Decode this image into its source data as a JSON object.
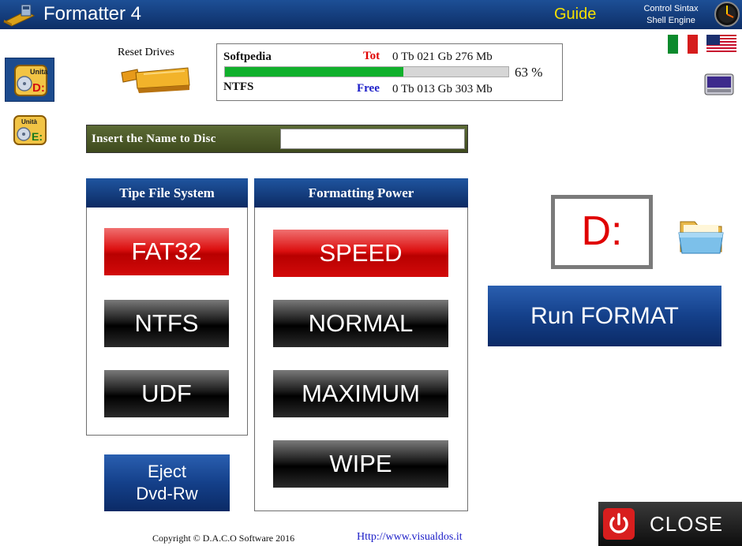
{
  "app": {
    "title": "Formatter 4",
    "guide_label": "Guide",
    "control_syntax_line1": "Control Sintax",
    "control_syntax_line2": "Shell Engine"
  },
  "sidebar": {
    "drive_d_label": "Unità",
    "drive_d_letter": "D:",
    "drive_e_label": "Unità",
    "drive_e_letter": "E:"
  },
  "reset": {
    "label": "Reset Drives"
  },
  "drive_info": {
    "name": "Softpedia",
    "file_system": "NTFS",
    "tot_label": "Tot",
    "tot_value": "0 Tb 021 Gb 276 Mb",
    "free_label": "Free",
    "free_value": "0 Tb 013 Gb 303 Mb",
    "used_percent": 63,
    "used_percent_text": "63 %"
  },
  "name_bar": {
    "label": "Insert the Name to Disc",
    "value": ""
  },
  "file_system_group": {
    "title": "Tipe File System",
    "options": [
      "FAT32",
      "NTFS",
      "UDF"
    ],
    "selected": "FAT32"
  },
  "power_group": {
    "title": "Formatting Power",
    "options": [
      "SPEED",
      "NORMAL",
      "MAXIMUM",
      "WIPE"
    ],
    "selected": "SPEED"
  },
  "drive_letter": "D:",
  "run_label": "Run FORMAT",
  "eject": {
    "line1": "Eject",
    "line2": "Dvd-Rw"
  },
  "footer": {
    "copyright": "Copyright © D.A.C.O Software 2016",
    "website": "Http://www.visualdos.it"
  },
  "close_label": "CLOSE",
  "colors": {
    "title_bar": "#0d2e66",
    "guide": "#f6e000",
    "selected_red": "#dc1010",
    "progress": "#11b02c",
    "drive_letter": "#e00000"
  }
}
